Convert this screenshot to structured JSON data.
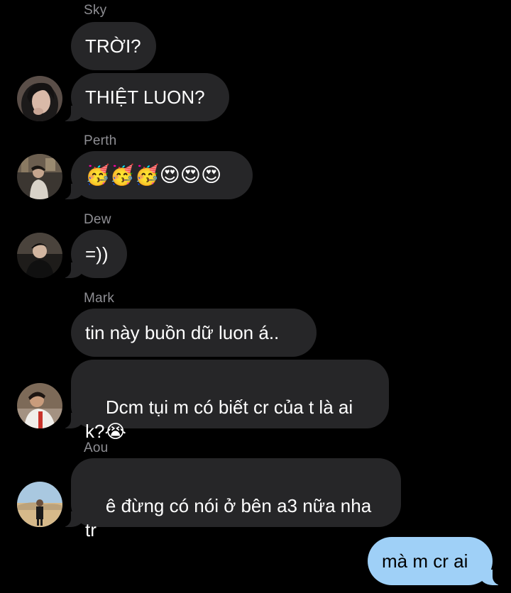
{
  "messages": [
    {
      "sender": "Sky",
      "text": "TRỜI?"
    },
    {
      "sender": "Sky",
      "text": "THIỆT LUON?"
    },
    {
      "sender": "Perth",
      "text": "🥳🥳🥳😍😍😍"
    },
    {
      "sender": "Dew",
      "text": "=))"
    },
    {
      "sender": "Mark",
      "text": "tin này buồn dữ luon á.."
    },
    {
      "sender": "Mark",
      "text": "Dcm tụi m có biết cr của t là ai\nk?😭"
    },
    {
      "sender": "Aou",
      "text": "ê đừng có nói ở bên a3 nữa nha\ntr"
    },
    {
      "sender": "me",
      "text": "mà m cr ai"
    }
  ],
  "colors": {
    "background": "#000000",
    "incoming_bubble": "#262628",
    "outgoing_bubble": "#9fd0f7",
    "sender_name": "#8e8e93"
  }
}
